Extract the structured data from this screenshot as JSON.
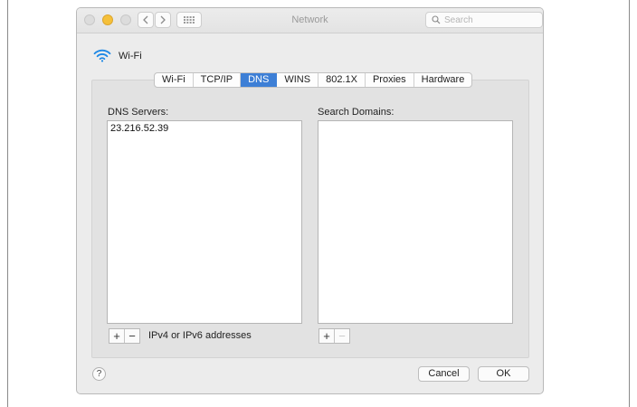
{
  "window": {
    "title": "Network",
    "search_placeholder": "Search"
  },
  "interface": {
    "label": "Wi-Fi"
  },
  "tabs": [
    {
      "label": "Wi-Fi",
      "active": false
    },
    {
      "label": "TCP/IP",
      "active": false
    },
    {
      "label": "DNS",
      "active": true
    },
    {
      "label": "WINS",
      "active": false
    },
    {
      "label": "802.1X",
      "active": false
    },
    {
      "label": "Proxies",
      "active": false
    },
    {
      "label": "Hardware",
      "active": false
    }
  ],
  "dns": {
    "servers_label": "DNS Servers:",
    "servers": [
      "23.216.52.39"
    ],
    "hint": "IPv4 or IPv6 addresses"
  },
  "search_domains": {
    "label": "Search Domains:",
    "domains": []
  },
  "controls": {
    "add": "+",
    "remove": "−"
  },
  "footer": {
    "help": "?",
    "cancel": "Cancel",
    "ok": "OK"
  },
  "colors": {
    "accent": "#3d7fd6",
    "minimize_light": "#f5c03a"
  }
}
